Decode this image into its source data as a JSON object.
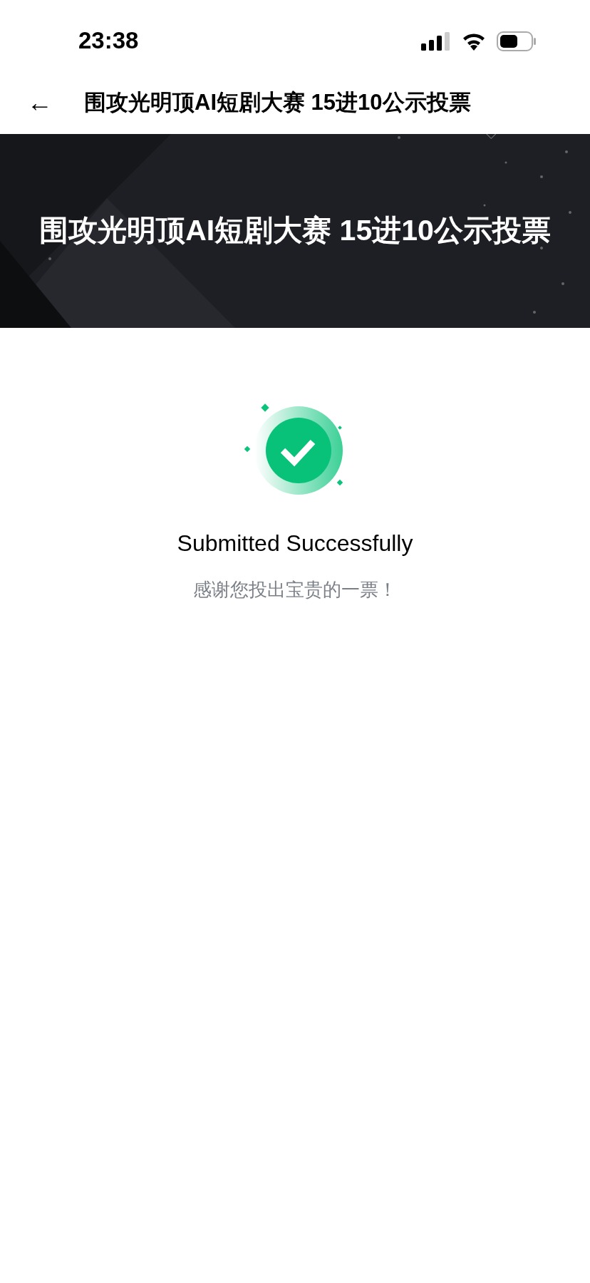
{
  "status_bar": {
    "time": "23:38"
  },
  "nav_bar": {
    "back": "←",
    "title": "围攻光明顶AI短剧大赛 15进10公示投票"
  },
  "banner": {
    "title": "围攻光明顶AI短剧大赛 15进10公示投票"
  },
  "result": {
    "kind": "success",
    "title": "Submitted Successfully",
    "message": "感谢您投出宝贵的一票！"
  }
}
